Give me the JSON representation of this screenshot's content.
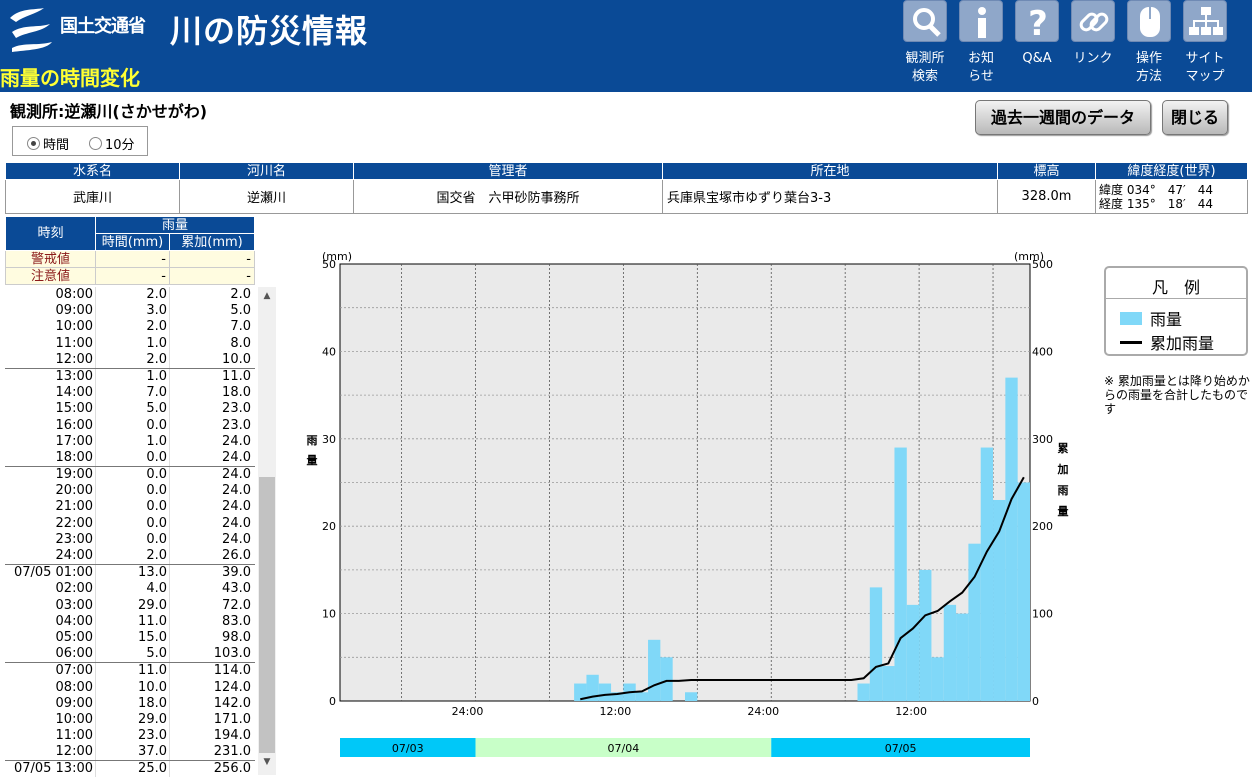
{
  "header": {
    "ministry": "国土交通省",
    "site_title": "川の防災情報",
    "page_title": "雨量の時間変化",
    "nav": [
      {
        "label": "観測所\n検索",
        "icon": "magnifier-icon"
      },
      {
        "label": "お知\nらせ",
        "icon": "info-icon"
      },
      {
        "label": "Q&A",
        "icon": "question-icon"
      },
      {
        "label": "リンク",
        "icon": "link-icon"
      },
      {
        "label": "操作\n方法",
        "icon": "mouse-icon"
      },
      {
        "label": "サイト\nマップ",
        "icon": "sitemap-icon"
      }
    ]
  },
  "station": {
    "name": "観測所:逆瀬川(さかせがわ)",
    "past_week_button": "過去一週間のデータ",
    "close_button": "閉じる",
    "interval_options": [
      "時間",
      "10分"
    ],
    "interval_selected": "時間"
  },
  "info": {
    "headers": [
      "水系名",
      "河川名",
      "管理者",
      "所在地",
      "標高",
      "緯度経度(世界)"
    ],
    "values": [
      "武庫川",
      "逆瀬川",
      "国交省　六甲砂防事務所",
      "兵庫県宝塚市ゆずり葉台3-3",
      "328.0m"
    ],
    "lat": "緯度 034°　47′　44",
    "lon": "経度 135°　18′　44"
  },
  "table": {
    "col_time": "時刻",
    "col_rain": "雨量",
    "col_hourly": "時間(mm)",
    "col_cumulative": "累加(mm)",
    "warning_label": "警戒値",
    "caution_label": "注意値",
    "warning_hourly": "-",
    "warning_cum": "-",
    "caution_hourly": "-",
    "caution_cum": "-",
    "groups": [
      [
        [
          "08:00",
          "2.0",
          "2.0"
        ],
        [
          "09:00",
          "3.0",
          "5.0"
        ],
        [
          "10:00",
          "2.0",
          "7.0"
        ],
        [
          "11:00",
          "1.0",
          "8.0"
        ],
        [
          "12:00",
          "2.0",
          "10.0"
        ]
      ],
      [
        [
          "13:00",
          "1.0",
          "11.0"
        ],
        [
          "14:00",
          "7.0",
          "18.0"
        ],
        [
          "15:00",
          "5.0",
          "23.0"
        ],
        [
          "16:00",
          "0.0",
          "23.0"
        ],
        [
          "17:00",
          "1.0",
          "24.0"
        ],
        [
          "18:00",
          "0.0",
          "24.0"
        ]
      ],
      [
        [
          "19:00",
          "0.0",
          "24.0"
        ],
        [
          "20:00",
          "0.0",
          "24.0"
        ],
        [
          "21:00",
          "0.0",
          "24.0"
        ],
        [
          "22:00",
          "0.0",
          "24.0"
        ],
        [
          "23:00",
          "0.0",
          "24.0"
        ],
        [
          "24:00",
          "2.0",
          "26.0"
        ]
      ],
      [
        [
          "07/05 01:00",
          "13.0",
          "39.0"
        ],
        [
          "02:00",
          "4.0",
          "43.0"
        ],
        [
          "03:00",
          "29.0",
          "72.0"
        ],
        [
          "04:00",
          "11.0",
          "83.0"
        ],
        [
          "05:00",
          "15.0",
          "98.0"
        ],
        [
          "06:00",
          "5.0",
          "103.0"
        ]
      ],
      [
        [
          "07:00",
          "11.0",
          "114.0"
        ],
        [
          "08:00",
          "10.0",
          "124.0"
        ],
        [
          "09:00",
          "18.0",
          "142.0"
        ],
        [
          "10:00",
          "29.0",
          "171.0"
        ],
        [
          "11:00",
          "23.0",
          "194.0"
        ],
        [
          "12:00",
          "37.0",
          "231.0"
        ]
      ],
      [
        [
          "07/05 13:00",
          "25.0",
          "256.0"
        ]
      ]
    ]
  },
  "legend": {
    "title": "凡　例",
    "rain": "雨量",
    "cumulative": "累加雨量",
    "note": "※ 累加雨量とは降り始めからの雨量を合計したものです"
  },
  "colors": {
    "header_bg": "#0a4a96",
    "bar": "#80d8f8",
    "date_0703": "#00c8f8",
    "date_0704": "#c8ffc8",
    "date_0705": "#00c8f8"
  },
  "chart_data": {
    "type": "bar",
    "left_unit": "(mm)",
    "right_unit": "(mm)",
    "left_label": "雨量",
    "right_label": "累加雨量",
    "left_ylim": [
      0,
      50
    ],
    "right_ylim": [
      0,
      500
    ],
    "left_ticks": [
      "0",
      "10",
      "20",
      "30",
      "40",
      "50"
    ],
    "right_ticks": [
      "0",
      "100",
      "200",
      "300",
      "400",
      "500"
    ],
    "x_tick_labels": [
      "24:00",
      "12:00",
      "24:00",
      "12:00"
    ],
    "date_bands": [
      "07/03",
      "07/04",
      "07/05"
    ],
    "hours_start": "07/03 14:00",
    "hourly": [
      0,
      0,
      0,
      0,
      0,
      0,
      0,
      0,
      0,
      0,
      0,
      0,
      0,
      0,
      0,
      0,
      0,
      0,
      0,
      2,
      3,
      2,
      1,
      2,
      1,
      7,
      5,
      0,
      1,
      0,
      0,
      0,
      0,
      0,
      0,
      0,
      0,
      0,
      0,
      0,
      0,
      0,
      2,
      13,
      4,
      29,
      11,
      15,
      5,
      11,
      10,
      18,
      29,
      23,
      37,
      25
    ],
    "cumulative": [
      null,
      null,
      null,
      null,
      null,
      null,
      null,
      null,
      null,
      null,
      null,
      null,
      null,
      null,
      null,
      null,
      null,
      null,
      null,
      2,
      5,
      7,
      8,
      10,
      11,
      18,
      23,
      23,
      24,
      24,
      24,
      24,
      24,
      24,
      24,
      24,
      24,
      24,
      24,
      24,
      24,
      24,
      26,
      39,
      43,
      72,
      83,
      98,
      103,
      114,
      124,
      142,
      171,
      194,
      231,
      256
    ]
  }
}
